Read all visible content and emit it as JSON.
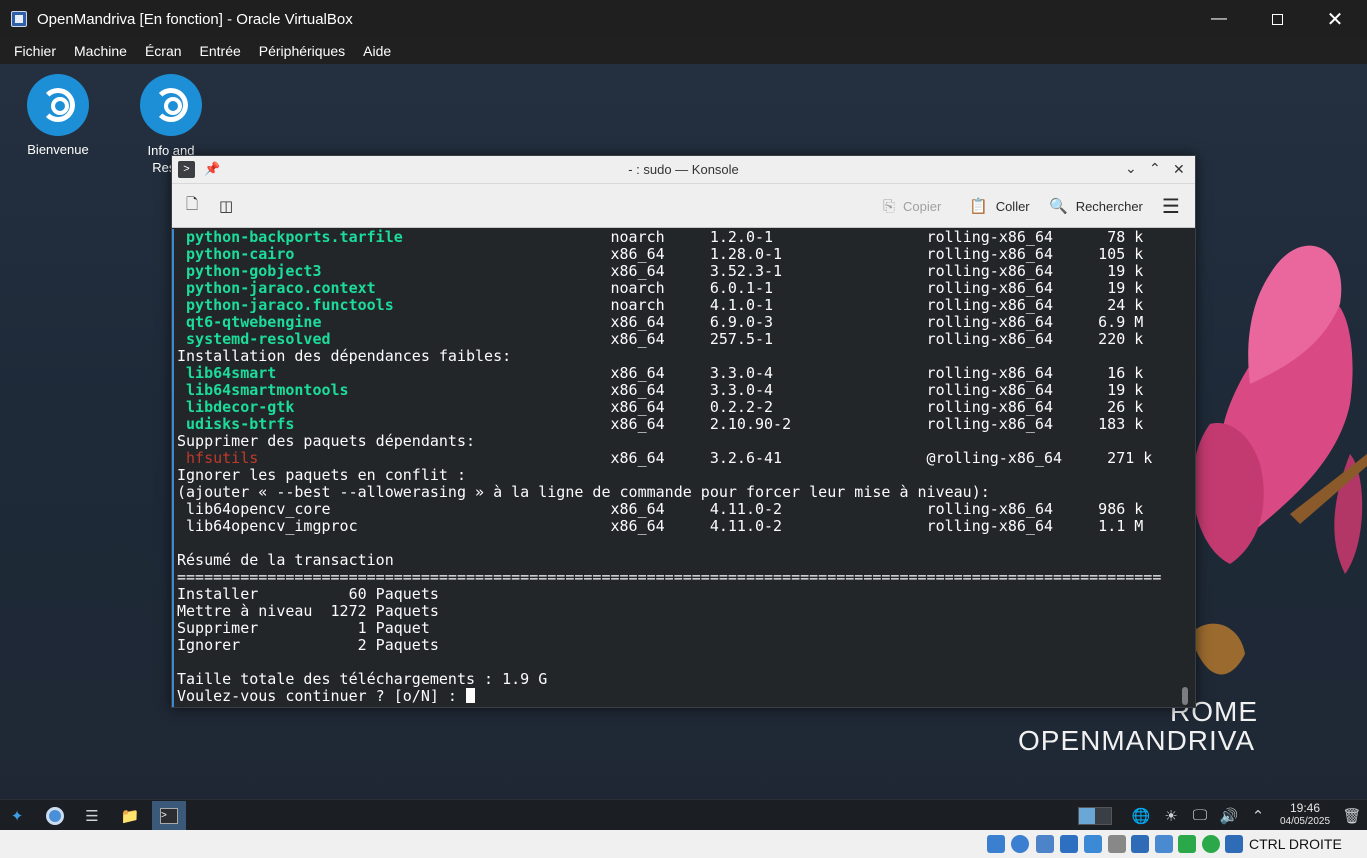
{
  "host": {
    "title": "OpenMandriva [En fonction] - Oracle VirtualBox",
    "menu": [
      "Fichier",
      "Machine",
      "Écran",
      "Entrée",
      "Périphériques",
      "Aide"
    ],
    "host_key": "CTRL DROITE"
  },
  "desktop": {
    "icons": [
      {
        "label": "Bienvenue"
      },
      {
        "label": "Info and Resou"
      }
    ],
    "brand_line1": "ROME",
    "brand_line2": "OPENMANDRIVA"
  },
  "konsole": {
    "title": "- : sudo — Konsole",
    "toolbar": {
      "copy_label": "Copier",
      "paste_label": "Coller",
      "search_label": "Rechercher"
    },
    "lines": [
      {
        "style": "pkg-new",
        "name": "python-backports.tarfile",
        "rest": "noarch     1.2.0-1                 rolling-x86_64      78 k"
      },
      {
        "style": "pkg-new",
        "name": "python-cairo",
        "rest": "x86_64     1.28.0-1                rolling-x86_64     105 k"
      },
      {
        "style": "pkg-new",
        "name": "python-gobject3",
        "rest": "x86_64     3.52.3-1                rolling-x86_64      19 k"
      },
      {
        "style": "pkg-new",
        "name": "python-jaraco.context",
        "rest": "noarch     6.0.1-1                 rolling-x86_64      19 k"
      },
      {
        "style": "pkg-new",
        "name": "python-jaraco.functools",
        "rest": "noarch     4.1.0-1                 rolling-x86_64      24 k"
      },
      {
        "style": "pkg-new",
        "name": "qt6-qtwebengine",
        "rest": "x86_64     6.9.0-3                 rolling-x86_64     6.9 M"
      },
      {
        "style": "pkg-new",
        "name": "systemd-resolved",
        "rest": "x86_64     257.5-1                 rolling-x86_64     220 k"
      },
      {
        "style": "plain",
        "text": "Installation des dépendances faibles:"
      },
      {
        "style": "pkg-new",
        "name": "lib64smart",
        "rest": "x86_64     3.3.0-4                 rolling-x86_64      16 k"
      },
      {
        "style": "pkg-new",
        "name": "lib64smartmontools",
        "rest": "x86_64     3.3.0-4                 rolling-x86_64      19 k"
      },
      {
        "style": "pkg-new",
        "name": "libdecor-gtk",
        "rest": "x86_64     0.2.2-2                 rolling-x86_64      26 k"
      },
      {
        "style": "pkg-new",
        "name": "udisks-btrfs",
        "rest": "x86_64     2.10.90-2               rolling-x86_64     183 k"
      },
      {
        "style": "plain",
        "text": "Supprimer des paquets dépendants:"
      },
      {
        "style": "pkg-rm",
        "name": "hfsutils",
        "rest": "x86_64     3.2.6-41                @rolling-x86_64     271 k"
      },
      {
        "style": "plain",
        "text": "Ignorer les paquets en conflit :"
      },
      {
        "style": "plain",
        "text": "(ajouter « --best --allowerasing » à la ligne de commande pour forcer leur mise à niveau):"
      },
      {
        "style": "pkg-plain",
        "name": "lib64opencv_core",
        "rest": "x86_64     4.11.0-2                rolling-x86_64     986 k"
      },
      {
        "style": "pkg-plain",
        "name": "lib64opencv_imgproc",
        "rest": "x86_64     4.11.0-2                rolling-x86_64     1.1 M"
      },
      {
        "style": "plain",
        "text": ""
      },
      {
        "style": "plain",
        "text": "Résumé de la transaction"
      },
      {
        "style": "plain",
        "text": "============================================================================================================="
      },
      {
        "style": "plain",
        "text": "Installer          60 Paquets"
      },
      {
        "style": "plain",
        "text": "Mettre à niveau  1272 Paquets"
      },
      {
        "style": "plain",
        "text": "Supprimer           1 Paquet"
      },
      {
        "style": "plain",
        "text": "Ignorer             2 Paquets"
      },
      {
        "style": "plain",
        "text": ""
      },
      {
        "style": "plain",
        "text": "Taille totale des téléchargements : 1.9 G"
      }
    ],
    "prompt": "Voulez-vous continuer ? [o/N] : "
  },
  "taskbar": {
    "time": "19:46",
    "date": "04/05/2025"
  },
  "colors": {
    "pkg_new": "#1cdc9a",
    "pkg_removed": "#c0392b",
    "terminal_bg": "#232629"
  }
}
